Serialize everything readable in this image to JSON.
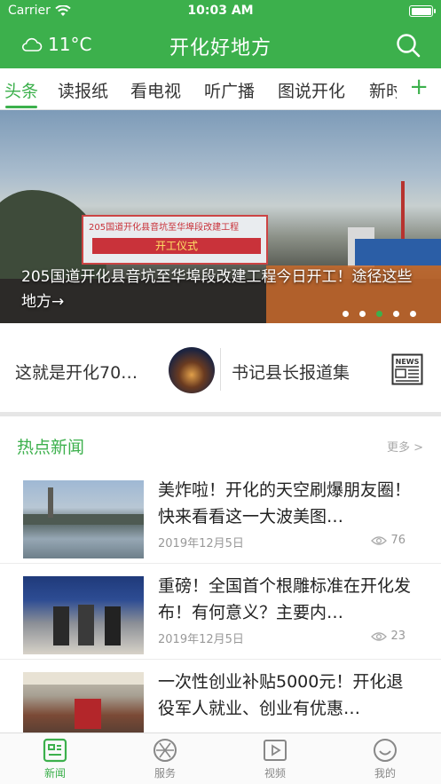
{
  "status_bar": {
    "carrier": "Carrier",
    "time": "10:03 AM"
  },
  "header": {
    "weather_temp": "11°C",
    "title": "开化好地方"
  },
  "tabs": [
    {
      "label": "头条",
      "active": true
    },
    {
      "label": "读报纸"
    },
    {
      "label": "看电视"
    },
    {
      "label": "听广播"
    },
    {
      "label": "图说开化"
    },
    {
      "label": "新时"
    }
  ],
  "tab_add": "+",
  "banner": {
    "caption": "205国道开化县音坑至华埠段改建工程今日开工！途径这些地方→",
    "sign_text": "205国道开化县音坑至华埠段改建工程",
    "sign_sub": "开工仪式",
    "dots": 6,
    "active_dot": 3
  },
  "promo": {
    "left_text": "这就是开化70…",
    "right_text": "书记县长报道集"
  },
  "hot_news": {
    "title": "热点新闻",
    "more": "更多 >",
    "items": [
      {
        "title": "美炸啦！开化的天空刷爆朋友圈！快来看看这一大波美图…",
        "date": "2019年12月5日",
        "views": "76"
      },
      {
        "title": "重磅！全国首个根雕标准在开化发布！有何意义？主要内…",
        "date": "2019年12月5日",
        "views": "23"
      },
      {
        "title": "一次性创业补贴5000元！开化退役军人就业、创业有优惠…",
        "date": "",
        "views": ""
      }
    ]
  },
  "bottom_nav": [
    {
      "label": "新闻",
      "icon": "news-icon",
      "active": true
    },
    {
      "label": "服务",
      "icon": "service-icon"
    },
    {
      "label": "视频",
      "icon": "video-icon"
    },
    {
      "label": "我的",
      "icon": "profile-icon"
    }
  ],
  "colors": {
    "brand_green": "#3cb04c"
  }
}
